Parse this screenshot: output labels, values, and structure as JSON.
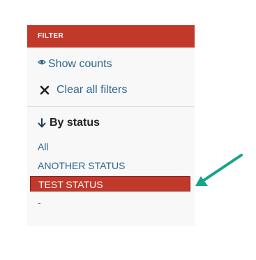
{
  "filter": {
    "header_label": "FILTER",
    "show_counts_label": "Show counts",
    "clear_filters_label": "Clear all filters",
    "section_title": "By status",
    "statuses": [
      {
        "label": "All",
        "active": false
      },
      {
        "label": "ANOTHER STATUS",
        "active": false
      },
      {
        "label": "TEST STATUS",
        "active": true
      },
      {
        "label": "-",
        "active": false
      }
    ]
  },
  "icons": {
    "show_counts": "eye-icon",
    "clear_filters": "x-icon",
    "section": "arrow-down-icon",
    "annotation": "teal-pointer-arrow"
  },
  "colors": {
    "accent": "#c0392b",
    "link": "#2f6690",
    "annotation_arrow": "#1aa38c",
    "panel_bg": "#f8f8f8"
  }
}
